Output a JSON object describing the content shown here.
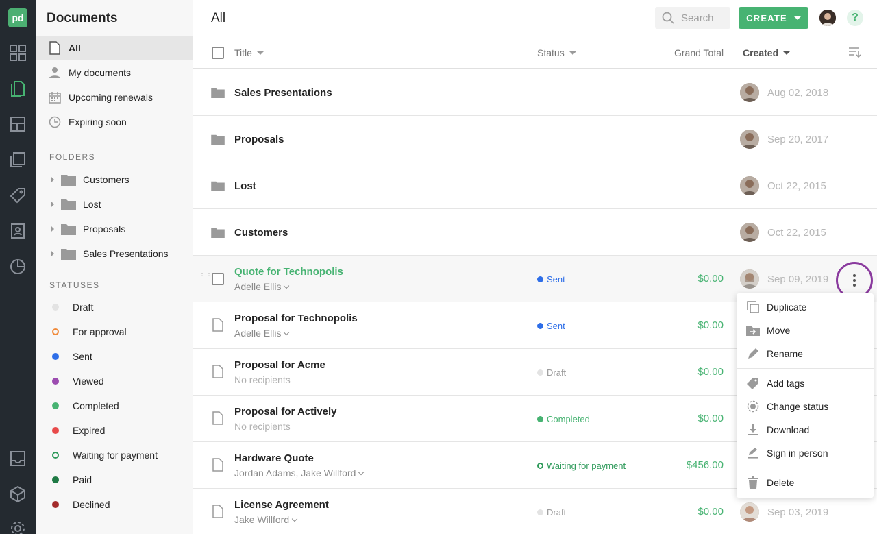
{
  "rail": {
    "logo": "pd",
    "icons": [
      "dashboard-icon",
      "documents-icon",
      "templates-icon",
      "content-library-icon",
      "catalog-icon",
      "contacts-icon",
      "reports-icon",
      "inbox-icon",
      "integrations-icon",
      "settings-icon"
    ]
  },
  "sidebar": {
    "title": "Documents",
    "views": [
      {
        "label": "All",
        "icon": "document-icon"
      },
      {
        "label": "My documents",
        "icon": "person-icon"
      },
      {
        "label": "Upcoming renewals",
        "icon": "calendar-icon"
      },
      {
        "label": "Expiring soon",
        "icon": "clock-icon"
      }
    ],
    "folders_heading": "FOLDERS",
    "folders": [
      "Customers",
      "Lost",
      "Proposals",
      "Sales Presentations"
    ],
    "statuses_heading": "STATUSES",
    "statuses": [
      {
        "label": "Draft",
        "color": "#e3e3e3",
        "style": "filled"
      },
      {
        "label": "For approval",
        "color": "#f08a3a",
        "style": "ring"
      },
      {
        "label": "Sent",
        "color": "#2e6ee8",
        "style": "filled"
      },
      {
        "label": "Viewed",
        "color": "#9c4cb0",
        "style": "filled"
      },
      {
        "label": "Completed",
        "color": "#47b372",
        "style": "filled"
      },
      {
        "label": "Expired",
        "color": "#e84a4a",
        "style": "filled"
      },
      {
        "label": "Waiting for payment",
        "color": "#2e9a5a",
        "style": "ring"
      },
      {
        "label": "Paid",
        "color": "#1f7a45",
        "style": "filled"
      },
      {
        "label": "Declined",
        "color": "#a32b2b",
        "style": "filled"
      }
    ]
  },
  "header": {
    "title": "All",
    "search_placeholder": "Search",
    "create_label": "CREATE",
    "help_label": "?"
  },
  "table": {
    "columns": {
      "title": "Title",
      "status": "Status",
      "grand_total": "Grand Total",
      "created": "Created"
    },
    "rows": [
      {
        "type": "folder",
        "name": "Sales Presentations",
        "date": "Aug 02, 2018"
      },
      {
        "type": "folder",
        "name": "Proposals",
        "date": "Sep 20, 2017"
      },
      {
        "type": "folder",
        "name": "Lost",
        "date": "Oct 22, 2015"
      },
      {
        "type": "folder",
        "name": "Customers",
        "date": "Oct 22, 2015"
      },
      {
        "type": "doc",
        "name": "Quote for Technopolis",
        "recipients": "Adelle Ellis",
        "status": "Sent",
        "status_color": "#2e6ee8",
        "total": "$0.00",
        "date": "Sep 09, 2019",
        "hover": true
      },
      {
        "type": "doc",
        "name": "Proposal for Technopolis",
        "recipients": "Adelle Ellis",
        "status": "Sent",
        "status_color": "#2e6ee8",
        "total": "$0.00"
      },
      {
        "type": "doc",
        "name": "Proposal for Acme",
        "recipients": "No recipients",
        "status": "Draft",
        "status_color": "#e3e3e3",
        "total": "$0.00"
      },
      {
        "type": "doc",
        "name": "Proposal for Actively",
        "recipients": "No recipients",
        "status": "Completed",
        "status_color": "#47b372",
        "total": "$0.00"
      },
      {
        "type": "doc",
        "name": "Hardware Quote",
        "recipients": "Jordan Adams, Jake Willford",
        "status": "Waiting for payment",
        "status_color": "#2e9a5a",
        "total": "$456.00"
      },
      {
        "type": "doc",
        "name": "License Agreement",
        "recipients": "Jake Willford",
        "status": "Draft",
        "status_color": "#e3e3e3",
        "total": "$0.00",
        "date": "Sep 03, 2019"
      }
    ]
  },
  "context_menu": {
    "items": [
      {
        "label": "Duplicate",
        "icon": "duplicate-icon"
      },
      {
        "label": "Move",
        "icon": "move-icon"
      },
      {
        "label": "Rename",
        "icon": "rename-icon"
      },
      {
        "label": "Add tags",
        "icon": "tag-icon"
      },
      {
        "label": "Change status",
        "icon": "status-icon"
      },
      {
        "label": "Download",
        "icon": "download-icon"
      },
      {
        "label": "Sign in person",
        "icon": "sign-icon"
      },
      {
        "label": "Delete",
        "icon": "trash-icon"
      }
    ]
  }
}
